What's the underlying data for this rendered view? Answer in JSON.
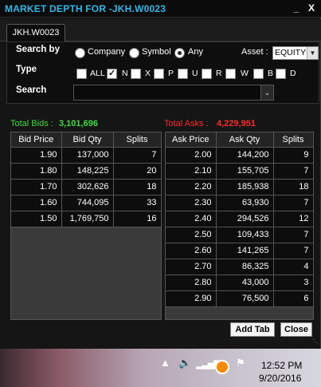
{
  "window": {
    "title": "MARKET DEPTH FOR -JKH.W0023",
    "minimize": "_",
    "close": "X",
    "tab": "JKH.W0023"
  },
  "search": {
    "search_by_label": "Search by",
    "options": [
      "Company",
      "Symbol",
      "Any"
    ],
    "selected_option": "Any",
    "asset_label": "Asset :",
    "asset_value": "EQUITY",
    "type_label": "Type",
    "types": [
      {
        "label": "ALL",
        "checked": false
      },
      {
        "label": "N",
        "checked": true
      },
      {
        "label": "X",
        "checked": false
      },
      {
        "label": "P",
        "checked": false
      },
      {
        "label": "U",
        "checked": false
      },
      {
        "label": "R",
        "checked": false
      },
      {
        "label": "W",
        "checked": false
      },
      {
        "label": "B",
        "checked": false
      },
      {
        "label": "D",
        "checked": false
      }
    ],
    "search_label": "Search",
    "search_value": ""
  },
  "totals": {
    "bids_label": "Total Bids :",
    "bids_value": "3,101,696",
    "asks_label": "Total Asks :",
    "asks_value": "4,229,951"
  },
  "bids": {
    "headers": [
      "Bid Price",
      "Bid Qty",
      "Splits"
    ],
    "rows": [
      [
        "1.90",
        "137,000",
        "7"
      ],
      [
        "1.80",
        "148,225",
        "20"
      ],
      [
        "1.70",
        "302,626",
        "18"
      ],
      [
        "1.60",
        "744,095",
        "33"
      ],
      [
        "1.50",
        "1,769,750",
        "16"
      ]
    ]
  },
  "asks": {
    "headers": [
      "Ask Price",
      "Ask Qty",
      "Splits"
    ],
    "rows": [
      [
        "2.00",
        "144,200",
        "9"
      ],
      [
        "2.10",
        "155,705",
        "7"
      ],
      [
        "2.20",
        "185,938",
        "18"
      ],
      [
        "2.30",
        "63,930",
        "7"
      ],
      [
        "2.40",
        "294,526",
        "12"
      ],
      [
        "2.50",
        "109,433",
        "7"
      ],
      [
        "2.60",
        "141,265",
        "7"
      ],
      [
        "2.70",
        "86,325",
        "4"
      ],
      [
        "2.80",
        "43,000",
        "3"
      ],
      [
        "2.90",
        "76,500",
        "6"
      ]
    ]
  },
  "buttons": {
    "add_tab": "Add Tab",
    "close": "Close"
  },
  "taskbar": {
    "time": "12:52 PM",
    "date": "9/20/2016",
    "icons": [
      "chevron-up-icon",
      "volume-icon",
      "network-signal-icon",
      "app-tray-icon",
      "flag-icon"
    ]
  }
}
